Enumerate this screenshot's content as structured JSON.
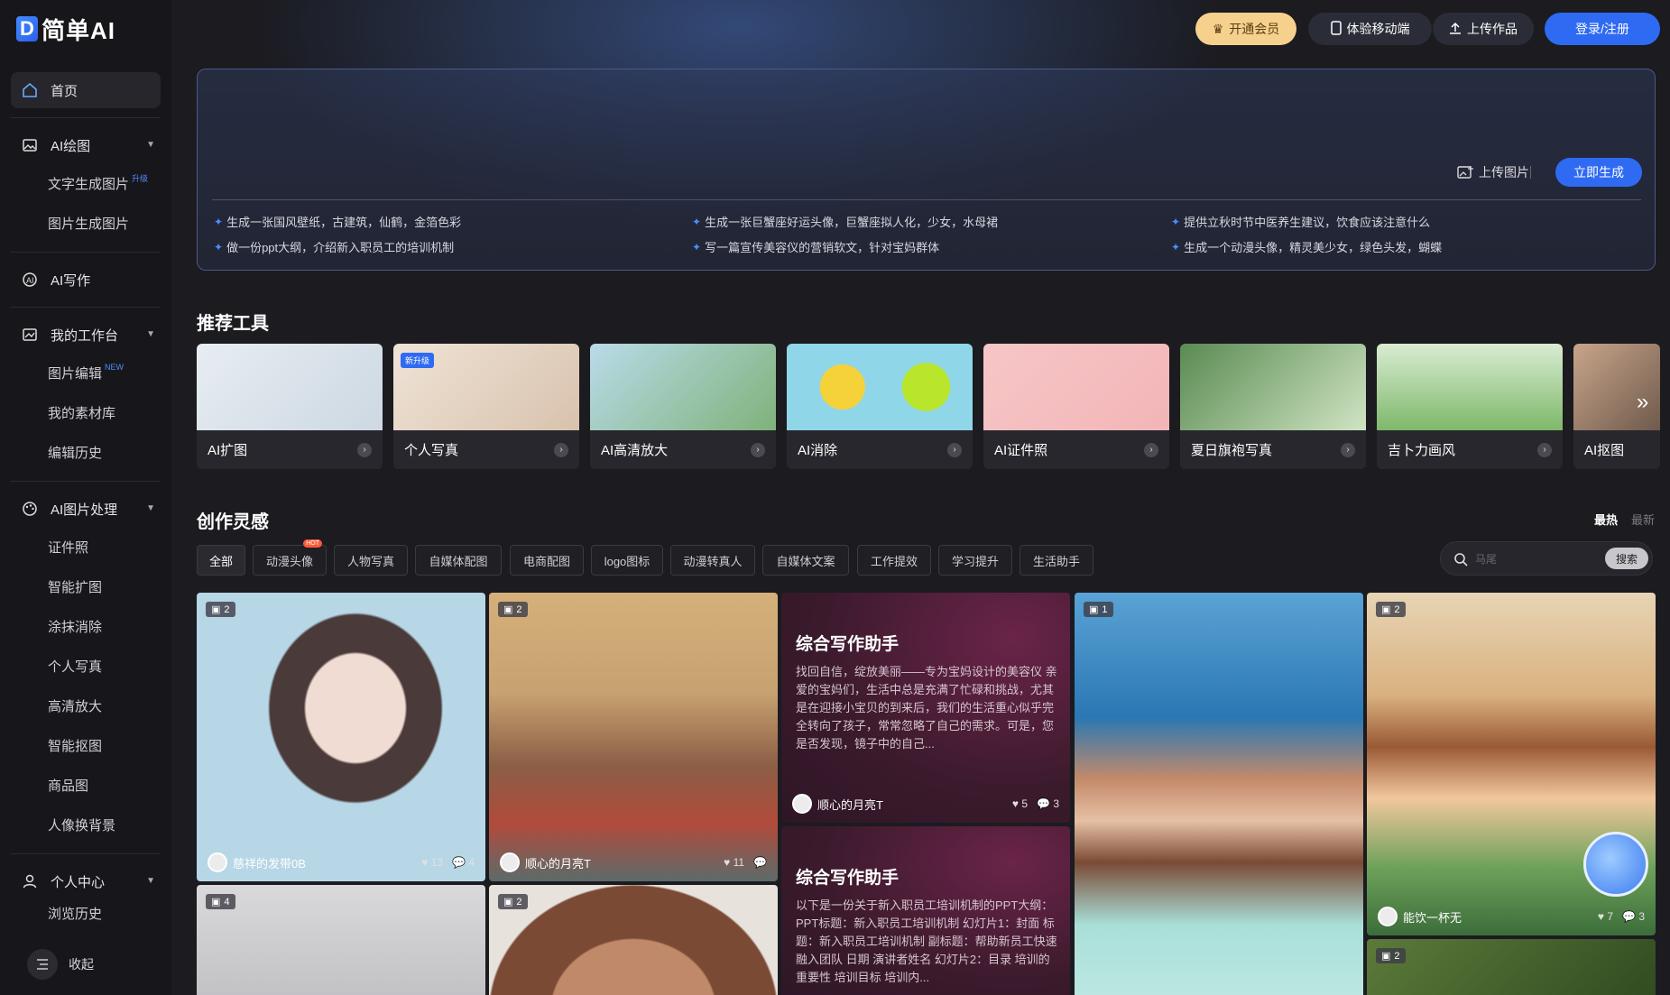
{
  "app": {
    "logo_letter": "D",
    "name": "简单AI"
  },
  "header": {
    "vip": "开通会员",
    "mobile": "体验移动端",
    "upload": "上传作品",
    "login": "登录/注册"
  },
  "sidebar": {
    "home": "首页",
    "ai_draw": {
      "label": "AI绘图",
      "items": [
        {
          "label": "文字生成图片",
          "badge": "升级"
        },
        {
          "label": "图片生成图片"
        }
      ]
    },
    "ai_write": "AI写作",
    "workbench": {
      "label": "我的工作台",
      "items": [
        {
          "label": "图片编辑",
          "badge": "NEW"
        },
        {
          "label": "我的素材库"
        },
        {
          "label": "编辑历史"
        }
      ]
    },
    "image_proc": {
      "label": "AI图片处理",
      "items": [
        "证件照",
        "智能扩图",
        "涂抹消除",
        "个人写真",
        "高清放大",
        "智能抠图",
        "商品图",
        "人像换背景"
      ]
    },
    "personal": {
      "label": "个人中心",
      "items": [
        "浏览历史"
      ]
    },
    "collapse": "收起"
  },
  "prompt": {
    "upload": "上传图片",
    "generate": "立即生成",
    "suggestions": [
      "生成一张国风壁纸，古建筑，仙鹤，金箔色彩",
      "生成一张巨蟹座好运头像，巨蟹座拟人化，少女，水母裙",
      "提供立秋时节中医养生建议，饮食应该注意什么",
      "做一份ppt大纲，介绍新入职员工的培训机制",
      "写一篇宣传美容仪的营销软文，针对宝妈群体",
      "生成一个动漫头像，精灵美少女，绿色头发，蝴蝶"
    ]
  },
  "tools": {
    "title": "推荐工具",
    "items": [
      {
        "label": "AI扩图"
      },
      {
        "label": "个人写真",
        "badge": "新升级"
      },
      {
        "label": "AI高清放大"
      },
      {
        "label": "AI消除"
      },
      {
        "label": "AI证件照"
      },
      {
        "label": "夏日旗袍写真"
      },
      {
        "label": "吉卜力画风"
      },
      {
        "label": "AI抠图"
      }
    ]
  },
  "inspiration": {
    "title": "创作灵感",
    "sort_hot": "最热",
    "sort_new": "最新",
    "chips": [
      "全部",
      "动漫头像",
      "人物写真",
      "自媒体配图",
      "电商配图",
      "logo图标",
      "动漫转真人",
      "自媒体文案",
      "工作提效",
      "学习提升",
      "生活助手"
    ],
    "hot_tag": "HOT",
    "search_placeholder": "马尾",
    "search_button": "搜索"
  },
  "gallery": {
    "card1": {
      "count": "2",
      "author": "慈祥的发带0B",
      "likes": "13",
      "comments": "4"
    },
    "card2": {
      "count": "2",
      "author": "顺心的月亮T",
      "likes": "11",
      "comments": ""
    },
    "text1": {
      "title": "综合写作助手",
      "body": "找回自信，绽放美丽——专为宝妈设计的美容仪 亲爱的宝妈们，生活中总是充满了忙碌和挑战，尤其是在迎接小宝贝的到来后，我们的生活重心似乎完全转向了孩子，常常忽略了自己的需求。可是，您是否发现，镜子中的自己...",
      "author": "顺心的月亮T",
      "likes": "5",
      "comments": "3"
    },
    "text2": {
      "title": "综合写作助手",
      "body": "以下是一份关于新入职员工培训机制的PPT大纲： PPT标题：新入职员工培训机制 幻灯片1：封面 标题：新入职员工培训机制 副标题：帮助新员工快速融入团队 日期 演讲者姓名 幻灯片2：目录 培训的重要性 培训目标 培训内..."
    },
    "card4": {
      "count": "1"
    },
    "card5": {
      "count": "2",
      "author": "能饮一杯无",
      "likes": "7",
      "comments": "3"
    },
    "card6": {
      "count": "4"
    },
    "card7": {
      "count": "2"
    },
    "card8": {
      "count": "2"
    }
  }
}
